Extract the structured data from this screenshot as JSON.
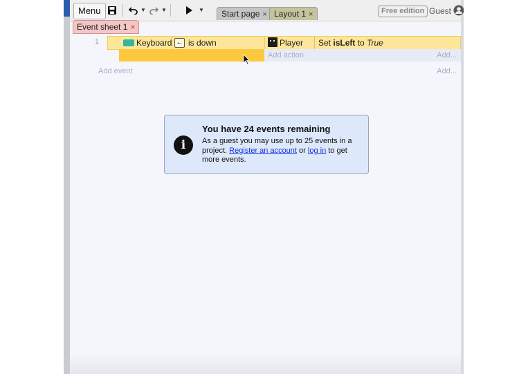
{
  "toolbar": {
    "menu_label": "Menu",
    "tabs": [
      {
        "label": "Start page"
      },
      {
        "label": "Layout 1"
      }
    ],
    "edition_badge": "Free edition",
    "user_label": "Guest",
    "tab_close_glyph": "×"
  },
  "sheet_tab": {
    "label": "Event sheet 1"
  },
  "event": {
    "number": "1",
    "condition": {
      "object": "Keyboard",
      "key_icon": "←",
      "text": "is down"
    },
    "action": {
      "object": "Player",
      "text_prefix": "Set ",
      "variable": "isLeft",
      "text_mid": " to ",
      "value": "True"
    },
    "add_action_label": "Add action",
    "add_more_label": "Add..."
  },
  "add_event_label": "Add event",
  "add_event_more_label": "Add...",
  "notice": {
    "title": "You have 24 events remaining",
    "body_1": "As a guest you may use up to 25 events in a project. ",
    "register_link": "Register an account",
    "body_2": " or ",
    "login_link": "log in",
    "body_3": " to get more events."
  },
  "colors": {
    "condition_bg": "#fde69a",
    "selected_sub_row": "#fcc93e",
    "notice_bg": "#dde8fb",
    "link": "#1530d8"
  },
  "icons": [
    "save-icon",
    "undo-icon",
    "redo-icon",
    "play-icon",
    "user-icon",
    "keyboard-icon",
    "arrow-left-icon",
    "info-icon",
    "mouse-cursor-icon"
  ]
}
